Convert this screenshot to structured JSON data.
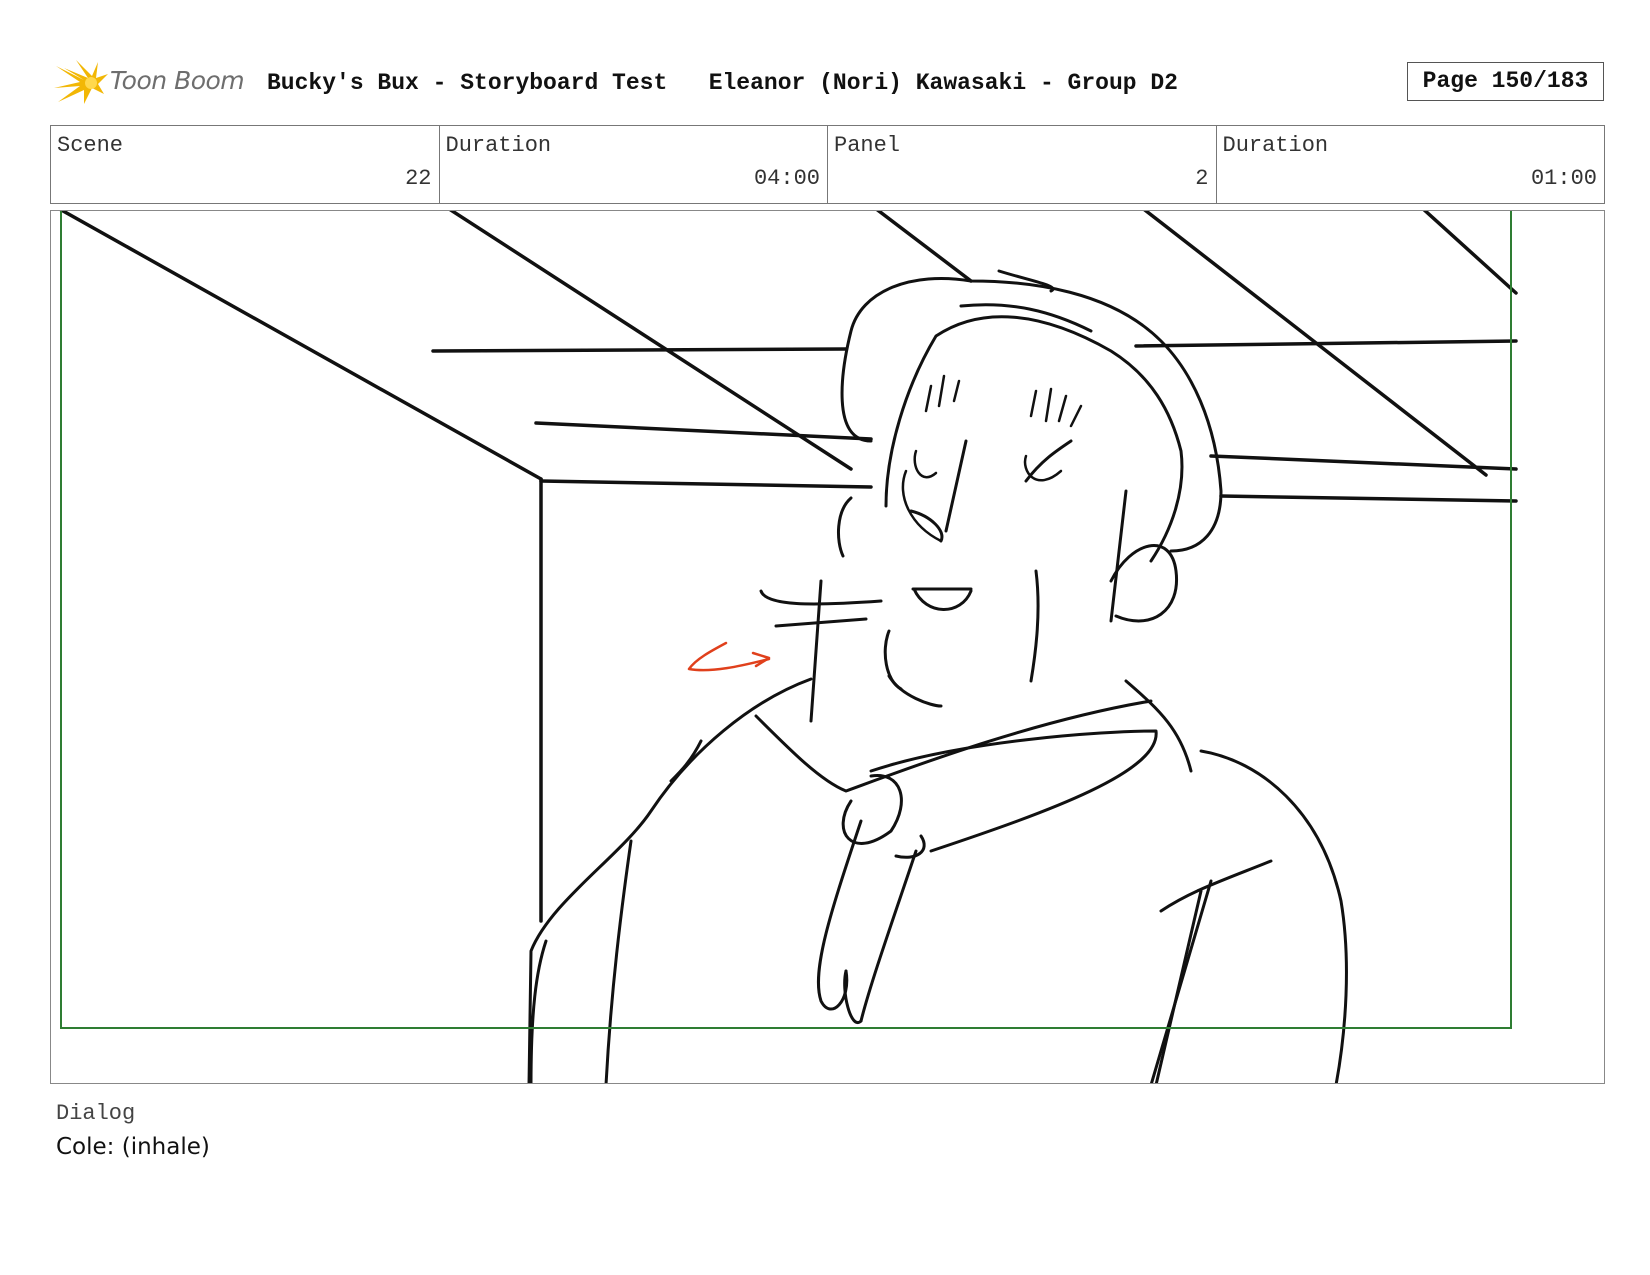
{
  "header": {
    "logo_text": "Toon Boom",
    "project_title": "Bucky's Bux - Storyboard Test",
    "author": "Eleanor (Nori) Kawasaki - Group D2",
    "page": "Page 150/183"
  },
  "info": [
    {
      "label": "Scene",
      "value": "22"
    },
    {
      "label": "Duration",
      "value": "04:00"
    },
    {
      "label": "Panel",
      "value": "2"
    },
    {
      "label": "Duration",
      "value": "01:00"
    }
  ],
  "dialog": {
    "label": "Dialog",
    "text": "Cole: (inhale)"
  },
  "colors": {
    "safe_frame": "#2e7d32",
    "annotation_arrow": "#e0401c",
    "logo_star": "#f2b705"
  }
}
